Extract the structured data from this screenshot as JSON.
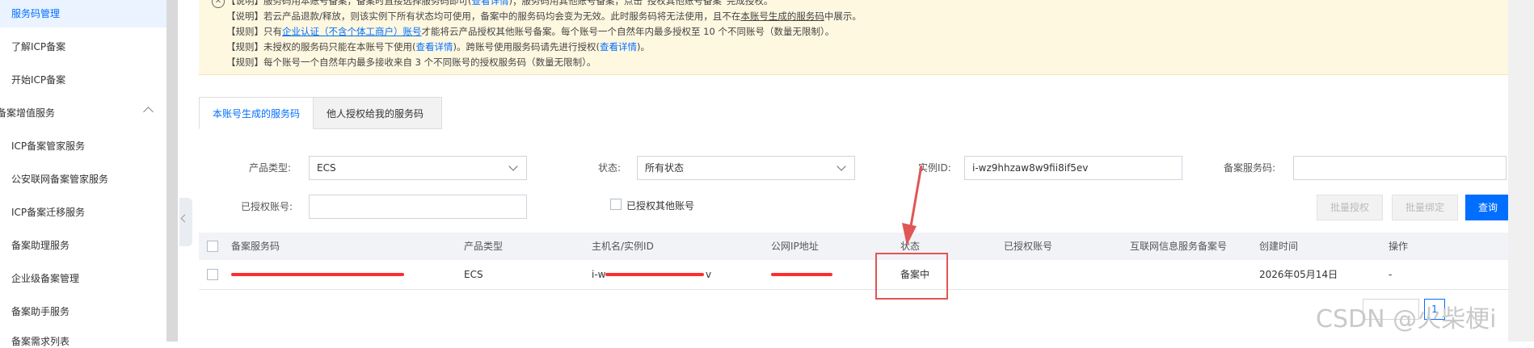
{
  "sidebar": {
    "items": [
      {
        "label": "服务码管理"
      },
      {
        "label": "了解ICP备案"
      },
      {
        "label": "开始ICP备案"
      },
      {
        "label": "备案增值服务"
      },
      {
        "label": "ICP备案管家服务"
      },
      {
        "label": "公安联网备案管家服务"
      },
      {
        "label": "ICP备案迁移服务"
      },
      {
        "label": "备案助理服务"
      },
      {
        "label": "企业级备案管理"
      },
      {
        "label": "备案助手服务"
      },
      {
        "label": "备案需求列表"
      }
    ]
  },
  "notice": {
    "line1_a": "【说明】服务码用本账号备案，备案时直接选择服务码即可(",
    "line1_link": "查看详情",
    "line1_b": ")；服务码用其他账号备案，点击“授权其他账号备案”完成授权。",
    "line2_a": "【说明】若云产品退款/释放，则该实例下所有状态均可使用，备案中的服务码均会变为无效。此时服务码将无法使用，且不在",
    "line2_link": "本账号生成的服务码",
    "line2_b": "中展示。",
    "line3_a": "【规则】只有",
    "line3_link": "企业认证（不含个体工商户）账号",
    "line3_b": "才能将云产品授权其他账号备案。每个账号一个自然年内最多授权至 10 个不同账号（数量无限制）。",
    "line4_a": "【规则】未授权的服务码只能在本账号下使用(",
    "line4_link1": "查看详情",
    "line4_b": ")。跨账号使用服务码请先进行授权(",
    "line4_link2": "查看详情",
    "line4_c": ")。",
    "line5": "【规则】每个账号一个自然年内最多接收来自 3 个不同账号的授权服务码（数量无限制）。"
  },
  "tabs": [
    {
      "label": "本账号生成的服务码"
    },
    {
      "label": "他人授权给我的服务码"
    }
  ],
  "filters": {
    "product_type_label": "产品类型:",
    "product_type_value": "ECS",
    "status_label": "状态:",
    "status_value": "所有状态",
    "instance_label": "实例ID:",
    "instance_value": "i-wz9hhzaw8w9fii8if5ev",
    "service_code_label": "备案服务码:",
    "service_code_value": "",
    "authorized_account_label": "已授权账号:",
    "authorized_account_value": "",
    "authorized_other_label": "已授权其他账号"
  },
  "buttons": {
    "batch_authorize": "批量授权",
    "batch_bind": "批量绑定",
    "query": "查询"
  },
  "table": {
    "headers": [
      "备案服务码",
      "产品类型",
      "主机名/实例ID",
      "公网IP地址",
      "状态",
      "已授权账号",
      "互联网信息服务备案号",
      "创建时间",
      "操作"
    ],
    "rows": [
      {
        "code": "",
        "product": "ECS",
        "host_prefix": "i-w",
        "host_suffix": "v",
        "ip": "",
        "status": "备案中",
        "authorized": "",
        "icp_no": "",
        "created": "2026年05月14日",
        "action": "-"
      }
    ]
  },
  "pagination": {
    "current": "1"
  },
  "watermark": "CSDN @火柴梗i",
  "colors": {
    "accent": "#006eff",
    "notice_bg": "#fff8e1",
    "annotation_red": "#e25555",
    "redaction": "#ff2d2d"
  }
}
